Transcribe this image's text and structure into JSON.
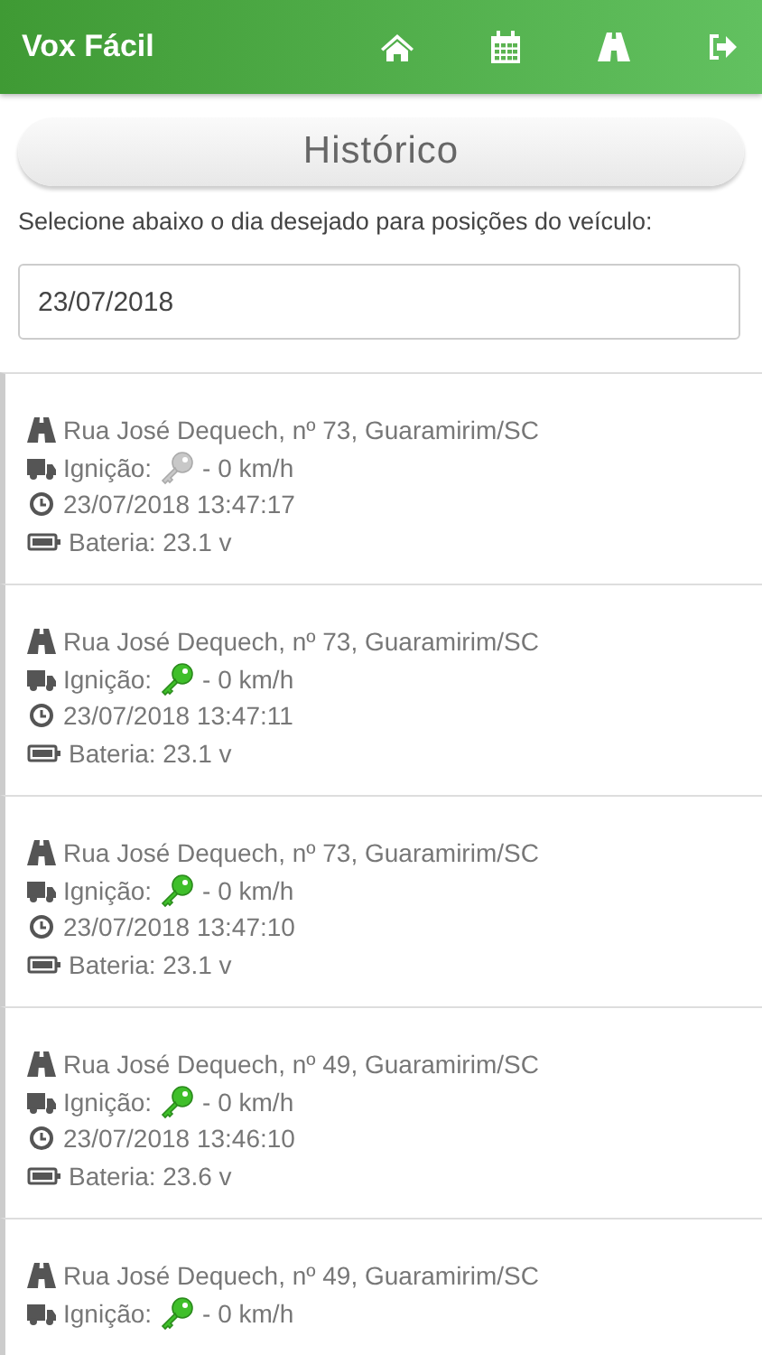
{
  "header": {
    "title": "Vox Fácil"
  },
  "page_title": "Histórico",
  "instruction": "Selecione abaixo o dia desejado para posições do veículo:",
  "date_field": {
    "value": "23/07/2018"
  },
  "positions": [
    {
      "address": "Rua José Dequech, nº 73, Guaramirim/SC",
      "ignition_label": "Ignição:",
      "ignition_on": false,
      "speed": "- 0 km/h",
      "time": "23/07/2018 13:47:17",
      "battery": "Bateria: 23.1 v"
    },
    {
      "address": "Rua José Dequech, nº 73, Guaramirim/SC",
      "ignition_label": "Ignição:",
      "ignition_on": true,
      "speed": "- 0 km/h",
      "time": "23/07/2018 13:47:11",
      "battery": "Bateria: 23.1 v"
    },
    {
      "address": "Rua José Dequech, nº 73, Guaramirim/SC",
      "ignition_label": "Ignição:",
      "ignition_on": true,
      "speed": "- 0 km/h",
      "time": "23/07/2018 13:47:10",
      "battery": "Bateria: 23.1 v"
    },
    {
      "address": "Rua José Dequech, nº 49, Guaramirim/SC",
      "ignition_label": "Ignição:",
      "ignition_on": true,
      "speed": "- 0 km/h",
      "time": "23/07/2018 13:46:10",
      "battery": "Bateria: 23.6 v"
    },
    {
      "address": "Rua José Dequech, nº 49, Guaramirim/SC",
      "ignition_label": "Ignição:",
      "ignition_on": true,
      "speed": "- 0 km/h"
    }
  ]
}
